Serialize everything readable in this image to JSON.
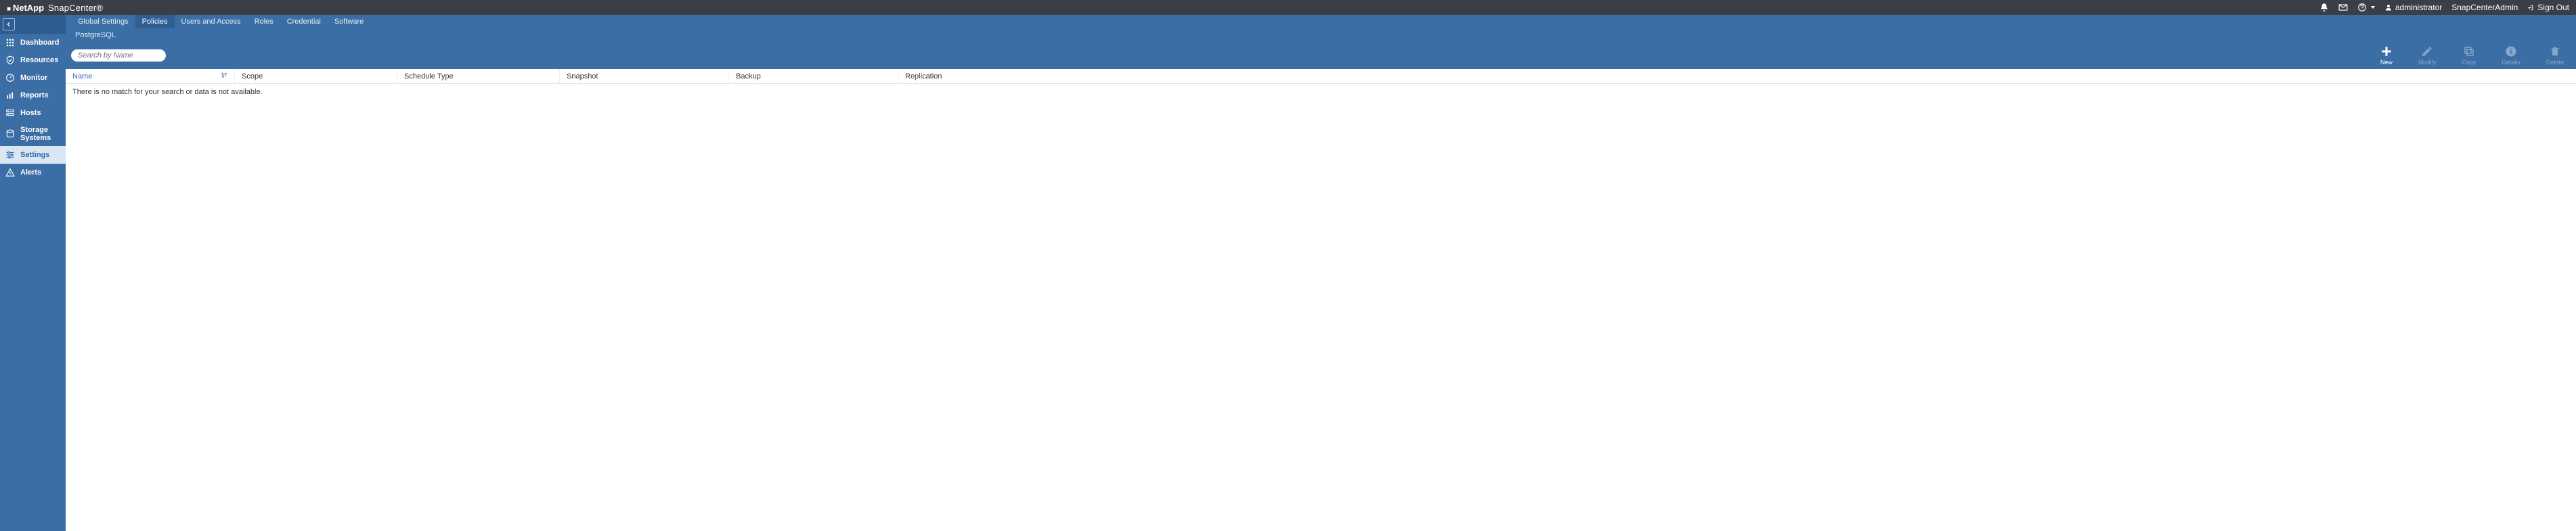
{
  "brand": {
    "company": "NetApp",
    "product": "SnapCenter®"
  },
  "header": {
    "user_label": "administrator",
    "tenant": "SnapCenterAdmin",
    "signout": "Sign Out"
  },
  "sidebar": {
    "items": [
      {
        "label": "Dashboard"
      },
      {
        "label": "Resources"
      },
      {
        "label": "Monitor"
      },
      {
        "label": "Reports"
      },
      {
        "label": "Hosts"
      },
      {
        "label": "Storage Systems"
      },
      {
        "label": "Settings"
      },
      {
        "label": "Alerts"
      }
    ]
  },
  "tabs": [
    "Global Settings",
    "Policies",
    "Users and Access",
    "Roles",
    "Credential",
    "Software"
  ],
  "breadcrumb": "PostgreSQL",
  "search": {
    "placeholder": "Search by Name"
  },
  "toolbar": {
    "new": "New",
    "modify": "Modify",
    "copy": "Copy",
    "details": "Details",
    "delete": "Delete"
  },
  "columns": {
    "name": "Name",
    "scope": "Scope",
    "schedule": "Schedule Type",
    "snapshot": "Snapshot",
    "backup": "Backup",
    "replication": "Replication"
  },
  "empty_msg": "There is no match for your search or data is not available."
}
